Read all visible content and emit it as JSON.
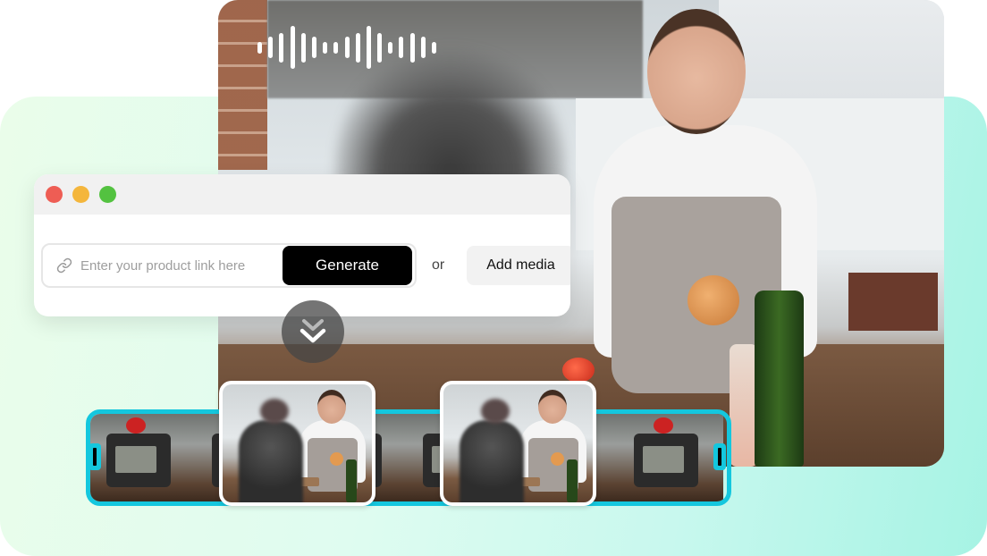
{
  "app": {
    "window_controls": [
      {
        "name": "close",
        "color": "#ee5d54"
      },
      {
        "name": "minimize",
        "color": "#f4b63c"
      },
      {
        "name": "maximize",
        "color": "#53c240"
      }
    ],
    "link_input": {
      "icon": "link-icon",
      "placeholder": "Enter your product link here",
      "value": ""
    },
    "generate_label": "Generate",
    "or_label": "or",
    "add_media_label": "Add media"
  },
  "media": {
    "waveform_icon": "audio-waveform",
    "waveform_levels": [
      0.28,
      0.5,
      0.68,
      1.0,
      0.68,
      0.5,
      0.28,
      0.28,
      0.5,
      0.68,
      1.0,
      0.68,
      0.28,
      0.5,
      0.68,
      0.5,
      0.28
    ],
    "chevron_icon": "double-chevron-down",
    "photo_description": "Woman in apron holding an onion in a kitchen, camera in foreground",
    "timeline": {
      "frame_count": 6,
      "selected_thumbnails": 2,
      "accent_color": "#14c7de"
    }
  },
  "colors": {
    "generate_bg": "#000000",
    "add_media_bg": "#f2f2f2",
    "background_gradient": [
      "#eafdea",
      "#a6f3e4"
    ]
  }
}
